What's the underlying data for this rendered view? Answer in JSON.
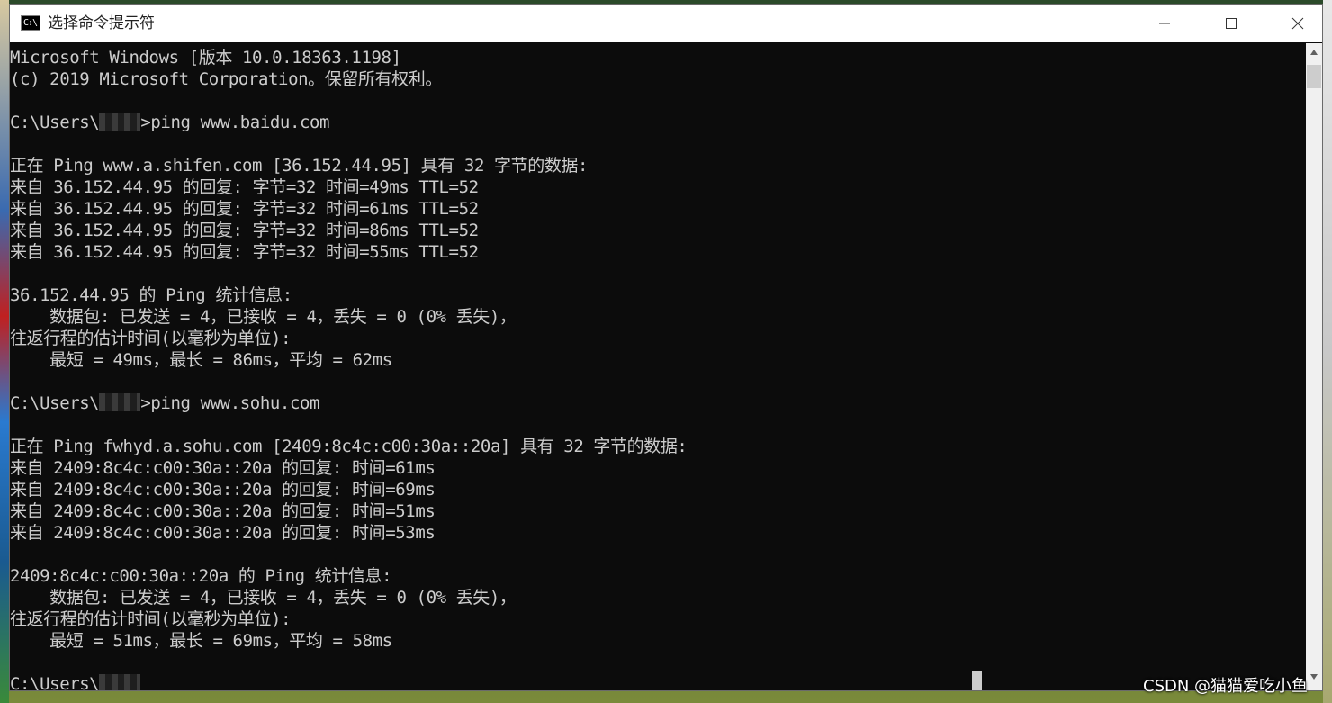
{
  "window": {
    "title": "选择命令提示符",
    "icon_label": "C:\\",
    "controls": [
      "minimize-icon",
      "maximize-icon",
      "close-icon"
    ]
  },
  "console": {
    "lines": [
      {
        "text": "Microsoft Windows [版本 10.0.18363.1198]"
      },
      {
        "text": "(c) 2019 Microsoft Corporation。保留所有权利。"
      },
      {
        "text": ""
      },
      {
        "prefix": "C:\\Users\\",
        "redacted": true,
        "suffix": ">ping www.baidu.com"
      },
      {
        "text": ""
      },
      {
        "text": "正在 Ping www.a.shifen.com [36.152.44.95] 具有 32 字节的数据:"
      },
      {
        "text": "来自 36.152.44.95 的回复: 字节=32 时间=49ms TTL=52"
      },
      {
        "text": "来自 36.152.44.95 的回复: 字节=32 时间=61ms TTL=52"
      },
      {
        "text": "来自 36.152.44.95 的回复: 字节=32 时间=86ms TTL=52"
      },
      {
        "text": "来自 36.152.44.95 的回复: 字节=32 时间=55ms TTL=52"
      },
      {
        "text": ""
      },
      {
        "text": "36.152.44.95 的 Ping 统计信息:"
      },
      {
        "text": "    数据包: 已发送 = 4，已接收 = 4，丢失 = 0 (0% 丢失)，"
      },
      {
        "text": "往返行程的估计时间(以毫秒为单位):"
      },
      {
        "text": "    最短 = 49ms，最长 = 86ms，平均 = 62ms"
      },
      {
        "text": ""
      },
      {
        "prefix": "C:\\Users\\",
        "redacted": true,
        "suffix": ">ping www.sohu.com"
      },
      {
        "text": ""
      },
      {
        "text": "正在 Ping fwhyd.a.sohu.com [2409:8c4c:c00:30a::20a] 具有 32 字节的数据:"
      },
      {
        "text": "来自 2409:8c4c:c00:30a::20a 的回复: 时间=61ms"
      },
      {
        "text": "来自 2409:8c4c:c00:30a::20a 的回复: 时间=69ms"
      },
      {
        "text": "来自 2409:8c4c:c00:30a::20a 的回复: 时间=51ms"
      },
      {
        "text": "来自 2409:8c4c:c00:30a::20a 的回复: 时间=53ms"
      },
      {
        "text": ""
      },
      {
        "text": "2409:8c4c:c00:30a::20a 的 Ping 统计信息:"
      },
      {
        "text": "    数据包: 已发送 = 4，已接收 = 4，丢失 = 0 (0% 丢失)，"
      },
      {
        "text": "往返行程的估计时间(以毫秒为单位):"
      },
      {
        "text": "    最短 = 51ms，最长 = 69ms，平均 = 58ms"
      },
      {
        "text": ""
      },
      {
        "prefix": "C:\\Users\\",
        "redacted": true,
        "suffix": ""
      }
    ]
  },
  "watermark": "CSDN @猫猫爱吃小鱼",
  "colors": {
    "console_bg": "#0c0c0c",
    "console_fg": "#cccccc",
    "titlebar_bg": "#ffffff",
    "scrollbar_bg": "#f0f0f0"
  }
}
